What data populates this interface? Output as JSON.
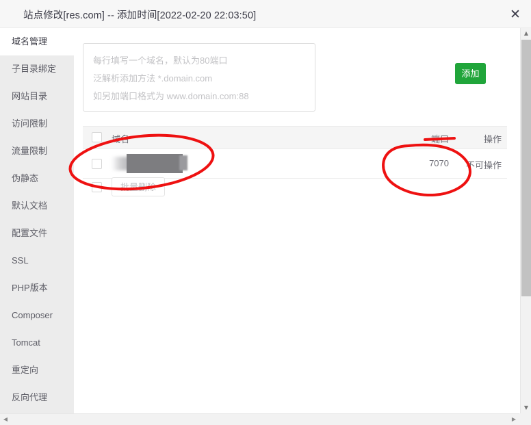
{
  "window": {
    "title": "站点修改[res.com] -- 添加时间[2022-02-20 22:03:50]",
    "close_label": "✕"
  },
  "sidebar": {
    "items": [
      {
        "label": "域名管理",
        "active": true
      },
      {
        "label": "子目录绑定",
        "active": false
      },
      {
        "label": "网站目录",
        "active": false
      },
      {
        "label": "访问限制",
        "active": false
      },
      {
        "label": "流量限制",
        "active": false
      },
      {
        "label": "伪静态",
        "active": false
      },
      {
        "label": "默认文档",
        "active": false
      },
      {
        "label": "配置文件",
        "active": false
      },
      {
        "label": "SSL",
        "active": false
      },
      {
        "label": "PHP版本",
        "active": false
      },
      {
        "label": "Composer",
        "active": false
      },
      {
        "label": "Tomcat",
        "active": false
      },
      {
        "label": "重定向",
        "active": false
      },
      {
        "label": "反向代理",
        "active": false
      }
    ]
  },
  "main": {
    "domain_input": {
      "value": "",
      "placeholder_lines": [
        "每行填写一个域名，默认为80端口",
        "泛解析添加方法 *.domain.com",
        "如另加端口格式为 www.domain.com:88"
      ]
    },
    "add_button_label": "添加",
    "table": {
      "headers": {
        "domain": "域名",
        "port": "端口",
        "operation": "操作"
      },
      "rows": [
        {
          "domain": "",
          "domain_redacted": true,
          "port": "7070",
          "operation": "不可操作",
          "checked": false
        }
      ]
    },
    "bulk_delete_label": "批量删除",
    "bulk_checkbox_checked": false
  },
  "annotations": {
    "color": "#ee1111",
    "marks": [
      {
        "name": "domain-column-ellipse",
        "shape": "ellipse"
      },
      {
        "name": "port-value-circle",
        "shape": "circle"
      },
      {
        "name": "port-header-underline",
        "shape": "line"
      }
    ]
  },
  "scrollbars": {
    "vertical": {
      "up_arrow": "▲",
      "down_arrow": "▼"
    },
    "horizontal": {
      "left_arrow": "◀",
      "right_arrow": "▶"
    }
  }
}
